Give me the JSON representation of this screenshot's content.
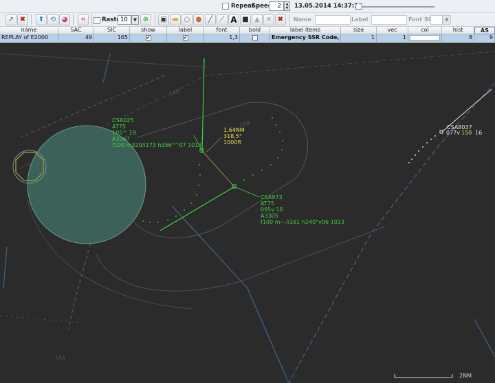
{
  "topbar": {
    "repeat_label": "Repeat",
    "speed_label": "Speed:",
    "speed_value": "2",
    "timestamp": "13.05.2014 14:37:19"
  },
  "toolbar": {
    "raster_label": "Raster",
    "raster_value": "10",
    "text_tool_glyph": "A",
    "name_label": "Name",
    "label_label": "Label",
    "fontsize_label": "Font Size"
  },
  "table": {
    "columns": [
      "name",
      "SAC",
      "SIC",
      "show",
      "label",
      "font",
      "bold",
      "label items",
      "size",
      "vec",
      "col",
      "hist",
      "AS"
    ],
    "row": {
      "name": "REPLAY of E2000",
      "sac": "49",
      "sic": "165",
      "show": true,
      "label": true,
      "font": "1,3",
      "bold": false,
      "label_items": "Emergency SSR Code, ACA...",
      "size": "1",
      "vec": "1",
      "col": "",
      "hist": "8",
      "as": "9"
    }
  },
  "radar": {
    "colors": {
      "background": "#2b2b2b",
      "track_green": "#3fd13f",
      "measure_yellow": "#e8e04a",
      "highlight_white": "#ffffff",
      "airspace_fill": "#3f6b62",
      "sector_line": "#3d5f86",
      "outline_gray": "#5a5a5a"
    },
    "tracks": [
      {
        "id": "CSA025",
        "lines": [
          "CSA025",
          "AT75",
          "105^ 19",
          "A3367",
          "f100 m320/i173 h356°^07 1013"
        ]
      },
      {
        "id": "CSA973",
        "lines": [
          "CSA973",
          "AT75",
          "095v 18",
          "A3305",
          "f100 m---/i161 h240°v06 1013"
        ]
      },
      {
        "id": "CSA8037",
        "lines": [
          "CSA8037",
          "077v",
          "150",
          "16"
        ]
      }
    ],
    "measurement": [
      "1,64NM",
      "318,5°",
      "1000ft"
    ],
    "faint_labels": [
      "LKB",
      "LKB",
      "LKR"
    ],
    "scale_label": "2NM"
  }
}
